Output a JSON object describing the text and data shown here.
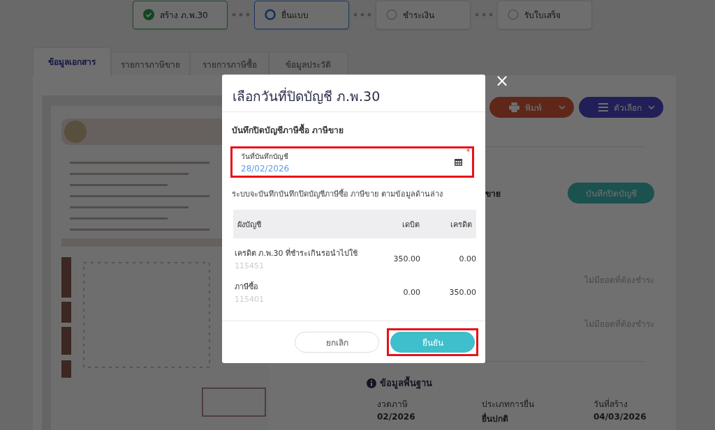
{
  "stepper": [
    {
      "label": "สร้าง ภ.พ.30",
      "completed": true,
      "selected": false
    },
    {
      "label": "ยื่นแบบ",
      "completed": false,
      "selected": true
    },
    {
      "label": "ชำระเงิน",
      "completed": false,
      "selected": false
    },
    {
      "label": "รับใบเสร็จ",
      "completed": false,
      "selected": false
    }
  ],
  "tabs": [
    {
      "label": "ข้อมูลเอกสาร",
      "selected": true
    },
    {
      "label": "รายการภาษีขาย",
      "selected": false
    },
    {
      "label": "รายการภาษีซื้อ",
      "selected": false
    },
    {
      "label": "ข้อมูลประวัติ",
      "selected": false
    }
  ],
  "document_preview": {
    "kind": "picture"
  },
  "toolbar": [
    {
      "label": "พิมพ์",
      "kind": "print"
    },
    {
      "label": "ตัวเลือก",
      "kind": "options"
    }
  ],
  "closing": {
    "label": "ขาย",
    "button": "บันทึกปิดบัญชี"
  },
  "payment_notes": [
    "ไม่มียอดที่ต้องชำระ",
    "ไม่มียอดที่ต้องชำระ"
  ],
  "basic_info": {
    "title": "ข้อมูลพื้นฐาน",
    "fields": [
      {
        "label": "งวดภาษี",
        "value": "02/2026"
      },
      {
        "label": "ประเภทการยื่น",
        "value": "ยื่นปกติ"
      },
      {
        "label": "วันที่สร้าง",
        "value": "04/03/2026"
      }
    ]
  },
  "modal": {
    "title": "เลือกวันที่ปิดบัญชี ภ.พ.30",
    "close": "×",
    "subtitle": "บันทึกปิดบัญชีภาษีซื้อ ภาษีขาย",
    "date_field": {
      "label": "วันที่บันทึกบัญชี",
      "value": "28/02/2026",
      "required_mark": "*",
      "highlighted": true
    },
    "description": "ระบบจะบันทึกบันทึกปิดบัญชีภาษีซื้อ ภาษีขาย ตามข้อมูลด้านล่าง",
    "table": {
      "columns": [
        "ผังบัญชี",
        "เดบิต",
        "เครดิต"
      ],
      "rows": [
        {
          "account": "เครดิต ภ.พ.30 ที่ชำระเกินรอนำไปใช้",
          "code": "115451",
          "debit": "350.00",
          "credit": "0.00"
        },
        {
          "account": "ภาษีซื้อ",
          "code": "115401",
          "debit": "0.00",
          "credit": "350.00"
        }
      ]
    },
    "buttons": [
      {
        "label": "ยกเลิก",
        "kind": "cancel",
        "highlighted": false
      },
      {
        "label": "ยืนยัน",
        "kind": "confirm",
        "highlighted": true
      }
    ]
  }
}
